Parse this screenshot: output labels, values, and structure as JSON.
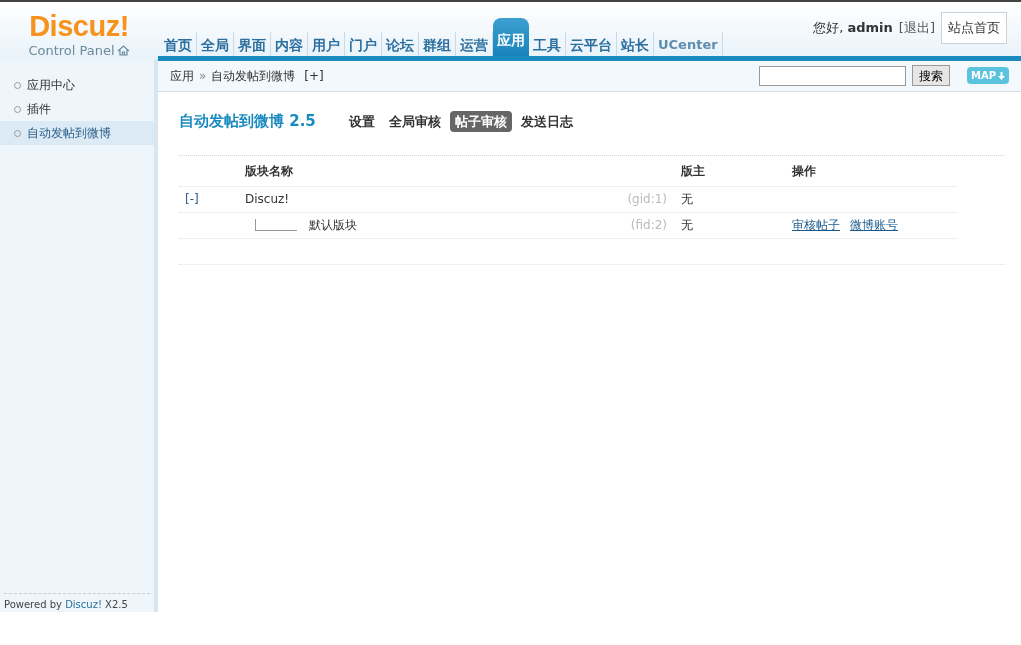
{
  "logo": {
    "title": "Discuz!",
    "subtitle": "Control Panel"
  },
  "nav": [
    {
      "label": "首页",
      "selected": false
    },
    {
      "label": "全局",
      "selected": false
    },
    {
      "label": "界面",
      "selected": false
    },
    {
      "label": "内容",
      "selected": false
    },
    {
      "label": "用户",
      "selected": false
    },
    {
      "label": "门户",
      "selected": false
    },
    {
      "label": "论坛",
      "selected": false
    },
    {
      "label": "群组",
      "selected": false
    },
    {
      "label": "运营",
      "selected": false
    },
    {
      "label": "应用",
      "selected": true
    },
    {
      "label": "工具",
      "selected": false
    },
    {
      "label": "云平台",
      "selected": false
    },
    {
      "label": "站长",
      "selected": false
    },
    {
      "label": "UCenter",
      "selected": false
    }
  ],
  "user": {
    "greeting": "您好,",
    "name": "admin",
    "logout": "[退出]",
    "site_home": "站点首页"
  },
  "breadcrumb": {
    "items": [
      "应用",
      "自动发帖到微博"
    ],
    "separator": "»",
    "toggle": "[+]"
  },
  "search": {
    "button": "搜索",
    "map_button": "MAP"
  },
  "sidebar": {
    "items": [
      {
        "label": "应用中心",
        "selected": false
      },
      {
        "label": "插件",
        "selected": false
      },
      {
        "label": "自动发帖到微博",
        "selected": true
      }
    ],
    "footer": {
      "prefix": "Powered by",
      "brand": "Discuz!",
      "version": "X2.5"
    }
  },
  "page_title": "自动发帖到微博 2.5",
  "tabs": [
    {
      "label": "设置",
      "selected": false
    },
    {
      "label": "全局审核",
      "selected": false
    },
    {
      "label": "帖子审核",
      "selected": true
    },
    {
      "label": "发送日志",
      "selected": false
    }
  ],
  "table": {
    "columns": [
      "版块名称",
      "版主",
      "操作"
    ],
    "rows": [
      {
        "kind": "group",
        "toggle": "[-]",
        "name": "Discuz!",
        "id": "(gid:1)",
        "moderator": "无",
        "actions": []
      },
      {
        "kind": "forum",
        "name": "默认版块",
        "id": "(fid:2)",
        "moderator": "无",
        "actions": [
          "审核帖子",
          "微博账号"
        ]
      }
    ]
  }
}
